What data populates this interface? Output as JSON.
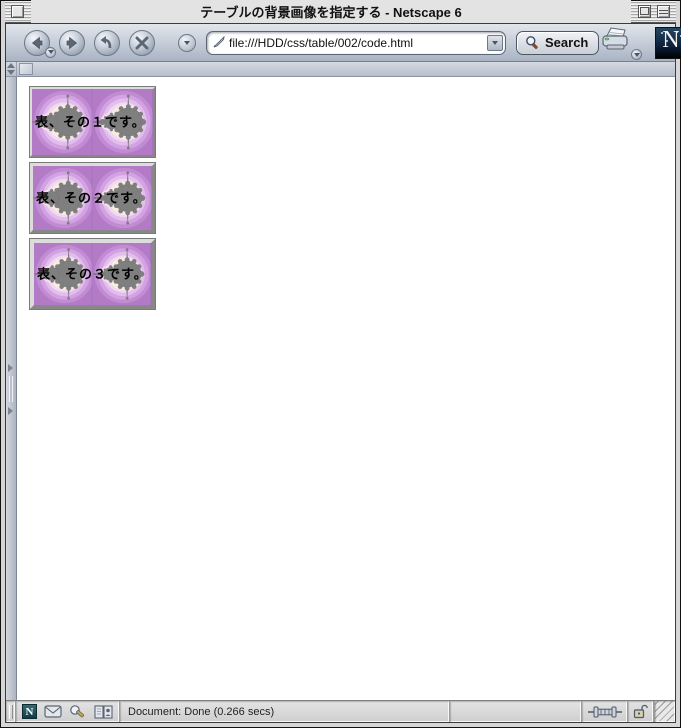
{
  "window": {
    "title": "テーブルの背景画像を指定する - Netscape 6"
  },
  "toolbar": {
    "url_value": "file:///HDD/css/table/002/code.html",
    "search_label": "Search",
    "logo_letter": "N",
    "icons": {
      "back": "back-arrow",
      "forward": "forward-arrow",
      "reload": "reload-arrow",
      "stop": "stop-x",
      "bookmark": "pencil-bookmark",
      "search": "magnifier",
      "print": "printer"
    }
  },
  "main": {
    "tables": [
      {
        "label": "表、その１です。"
      },
      {
        "label": "表、その２です。"
      },
      {
        "label": "表、その３です。"
      }
    ]
  },
  "statusbar": {
    "status_text": "Document: Done (0.266 secs)",
    "mini_logo_letter": "N"
  },
  "colors": {
    "fractal_purple": "#b87fcb",
    "fractal_gray": "#7f7f7f",
    "toolbar_top": "#e2e6ec",
    "toolbar_bottom": "#a9b3c2",
    "netscape_logo_bg": "#0d2340"
  }
}
